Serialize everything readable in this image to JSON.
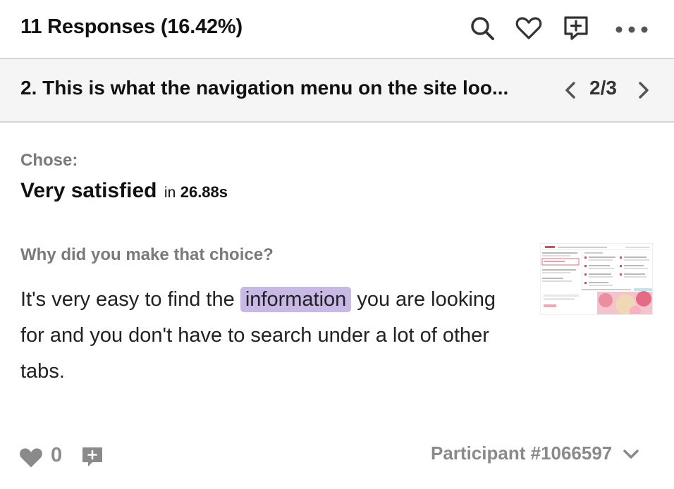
{
  "header": {
    "title": "11 Responses (16.42%)",
    "icons": [
      "search-icon",
      "heart-icon",
      "add-comment-icon",
      "more-icon"
    ]
  },
  "question_bar": {
    "text": "2. This is what the navigation menu on the site loo...",
    "pager": "2/3"
  },
  "response": {
    "chose_label": "Chose:",
    "answer": "Very satisfied",
    "in_word": "in",
    "duration": "26.88s",
    "why_label": "Why did you make that choice?",
    "text_before": "It's very easy to find the",
    "highlight": "information",
    "text_after": "you are looking for and you don't have to search under a lot of other tabs."
  },
  "footer": {
    "like_count": "0",
    "participant": "Participant #1066597"
  },
  "colors": {
    "highlight": "#c8b8e6",
    "muted_text": "#7a7a7a",
    "divider": "#d5d5d5",
    "question_bar_bg": "#f5f5f5"
  }
}
